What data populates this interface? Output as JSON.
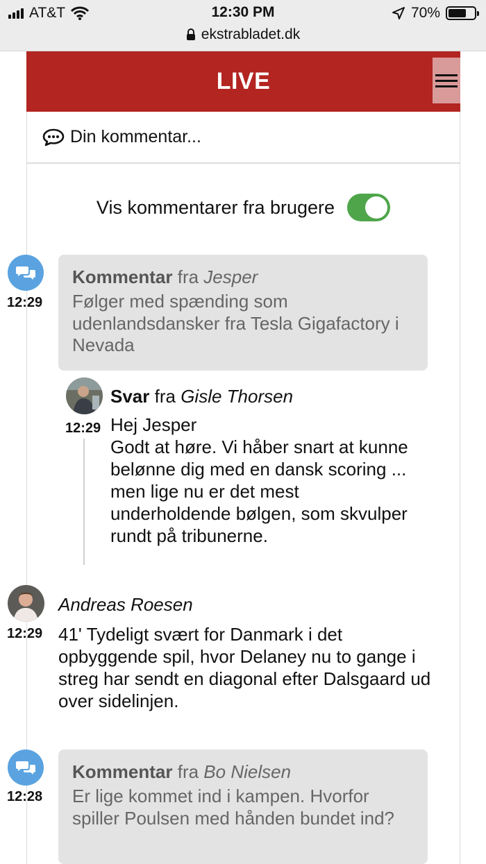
{
  "status_bar": {
    "carrier": "AT&T",
    "time": "12:30 PM",
    "battery": "70%",
    "battery_level": 0.7,
    "url": "ekstrabladet.dk"
  },
  "header": {
    "title": "LIVE"
  },
  "comment_input": {
    "placeholder": "Din kommentar..."
  },
  "toggle": {
    "label": "Vis kommentarer fra brugere",
    "on": true
  },
  "feed": {
    "item1": {
      "time": "12:29",
      "kind": "Kommentar",
      "from": "fra",
      "author": "Jesper",
      "text": "Følger med spænding som udenlandsdansker fra Tesla Gigafactory i Nevada",
      "reply": {
        "time": "12:29",
        "kind": "Svar",
        "from": "fra",
        "author": "Gisle Thorsen",
        "line1": "Hej Jesper",
        "text": "Godt at høre. Vi håber snart at kunne belønne dig med en dansk scoring ... men lige nu er det mest underholdende bølgen, som skvulper rundt på tribunerne."
      }
    },
    "item2": {
      "time": "12:29",
      "author": "Andreas Roesen",
      "text": "41' Tydeligt svært for Danmark i det opbyggende spil, hvor Delaney nu to gange i streg har sendt en diagonal efter Dalsgaard ud over sidelinjen."
    },
    "item3": {
      "time": "12:28",
      "kind": "Kommentar",
      "from": "fra",
      "author": "Bo Nielsen",
      "text": "Er lige kommet ind i kampen. Hvorfor spiller Poulsen med hånden bundet ind?"
    }
  }
}
